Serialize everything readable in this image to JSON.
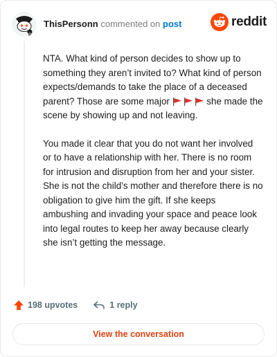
{
  "comment": {
    "username": "ThisPersonn",
    "action_text": "commented on",
    "target_link": "post",
    "paragraphs": [
      "NTA. What kind of person decides to show up to something they aren’t invited to? What kind of person expects/demands to take the place of a deceased parent? Those are some major",
      "she made the scene by showing up and not leaving.",
      "You made it clear that you do not want her involved or to have a relationship with her. There is no room for intrusion and disruption from her and your sister. She is not the child’s mother and therefore there is no obligation to give him the gift. If she keeps ambushing and invading your space and peace look into legal routes to keep her away because clearly she isn’t getting the message."
    ],
    "inline_emoji": "red-flag-icon x3"
  },
  "brand": {
    "wordmark": "reddit",
    "accent": "#ff4500"
  },
  "footer": {
    "upvotes_label": "198 upvotes",
    "replies_label": "1 reply",
    "upvote_color": "#ff4500"
  },
  "cta": {
    "label": "View the conversation",
    "color": "#e0410f"
  }
}
